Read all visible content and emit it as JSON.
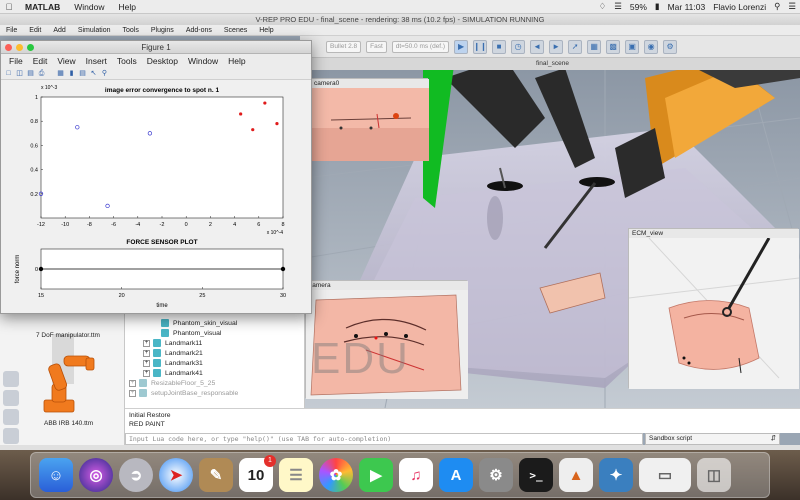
{
  "menubar": {
    "app_name": "MATLAB",
    "items": [
      "Window",
      "Help"
    ],
    "battery": "59%",
    "clock": "Mar 11:03",
    "user": "Flavio Lorenzi"
  },
  "vrep": {
    "title": "V-REP PRO EDU - final_scene - rendering: 38 ms (10.2 fps) - SIMULATION RUNNING",
    "menu": [
      "File",
      "Edit",
      "Add",
      "Simulation",
      "Tools",
      "Plugins",
      "Add-ons",
      "Scenes",
      "Help"
    ],
    "toolbar": {
      "engine_combo": "Bullet 2.8",
      "accuracy_combo": "Fast",
      "timestep_combo": "dt=50.0 ms (def.)"
    },
    "scene_tab": "final_scene",
    "inset_camera0": "camera0",
    "inset_camera": "camera",
    "inset_ecm": "ECM_view",
    "watermark": "EDU",
    "hierarchy": [
      {
        "label": "Phantom_skin_visual",
        "grey": false,
        "expand": ""
      },
      {
        "label": "Phantom_visual",
        "grey": false,
        "expand": ""
      },
      {
        "label": "Landmark11",
        "grey": false,
        "expand": "+"
      },
      {
        "label": "Landmark21",
        "grey": false,
        "expand": "+"
      },
      {
        "label": "Landmark31",
        "grey": false,
        "expand": "+"
      },
      {
        "label": "Landmark41",
        "grey": false,
        "expand": "+"
      },
      {
        "label": "ResizableFloor_5_25",
        "grey": true,
        "expand": "+"
      },
      {
        "label": "setupJointBase_responsable",
        "grey": true,
        "expand": "+"
      }
    ],
    "models": {
      "model1": "7 DoF manipulator.ttm",
      "model2": "ABB IRB 140.ttm"
    },
    "status_lines": [
      "Initial Restore",
      "RED PAINT"
    ],
    "command_placeholder": "Input Lua code here, or type \"help()\" (use TAB for auto-completion)",
    "sandbox_label": "Sandbox script"
  },
  "figure": {
    "window_title": "Figure 1",
    "menu": [
      "File",
      "Edit",
      "View",
      "Insert",
      "Tools",
      "Desktop",
      "Window",
      "Help"
    ],
    "toolbar_icons": [
      "new-icon",
      "open-icon",
      "save-icon",
      "print-icon",
      "data-cursor-icon",
      "colorbar-icon",
      "legend-icon",
      "arrow-icon",
      "zoom-icon"
    ]
  },
  "chart_data": [
    {
      "type": "scatter",
      "title": "image error convergence to spot n. 1",
      "xlabel": "",
      "ylabel": "",
      "x_exponent_label": "x 10^-4",
      "y_exponent_label": "x 10^-3",
      "xlim": [
        -12,
        8
      ],
      "ylim": [
        0,
        1
      ],
      "xticks": [
        -12,
        -10,
        -8,
        -6,
        -4,
        -2,
        0,
        2,
        4,
        6,
        8
      ],
      "yticks": [
        0.2,
        0.4,
        0.6,
        0.8,
        1
      ],
      "series": [
        {
          "color": "#3b3bd0",
          "marker": "open-circle",
          "points": [
            [
              -12,
              0.2
            ],
            [
              -9,
              0.75
            ],
            [
              -6.5,
              0.1
            ],
            [
              -3,
              0.7
            ]
          ]
        },
        {
          "color": "#e01b1b",
          "marker": "filled-dot",
          "points": [
            [
              4.5,
              0.86
            ],
            [
              5.5,
              0.73
            ],
            [
              6.5,
              0.95
            ],
            [
              7.5,
              0.78
            ]
          ]
        }
      ]
    },
    {
      "type": "line",
      "title": "FORCE SENSOR PLOT",
      "xlabel": "time",
      "ylabel": "force norm",
      "xlim": [
        15,
        30
      ],
      "ylim": [
        -1,
        1
      ],
      "xticks": [
        15,
        20,
        25,
        30
      ],
      "yticks": [
        0
      ],
      "series": [
        {
          "color": "#000000",
          "x": [
            15,
            30
          ],
          "values": [
            0,
            0
          ]
        }
      ]
    }
  ]
}
